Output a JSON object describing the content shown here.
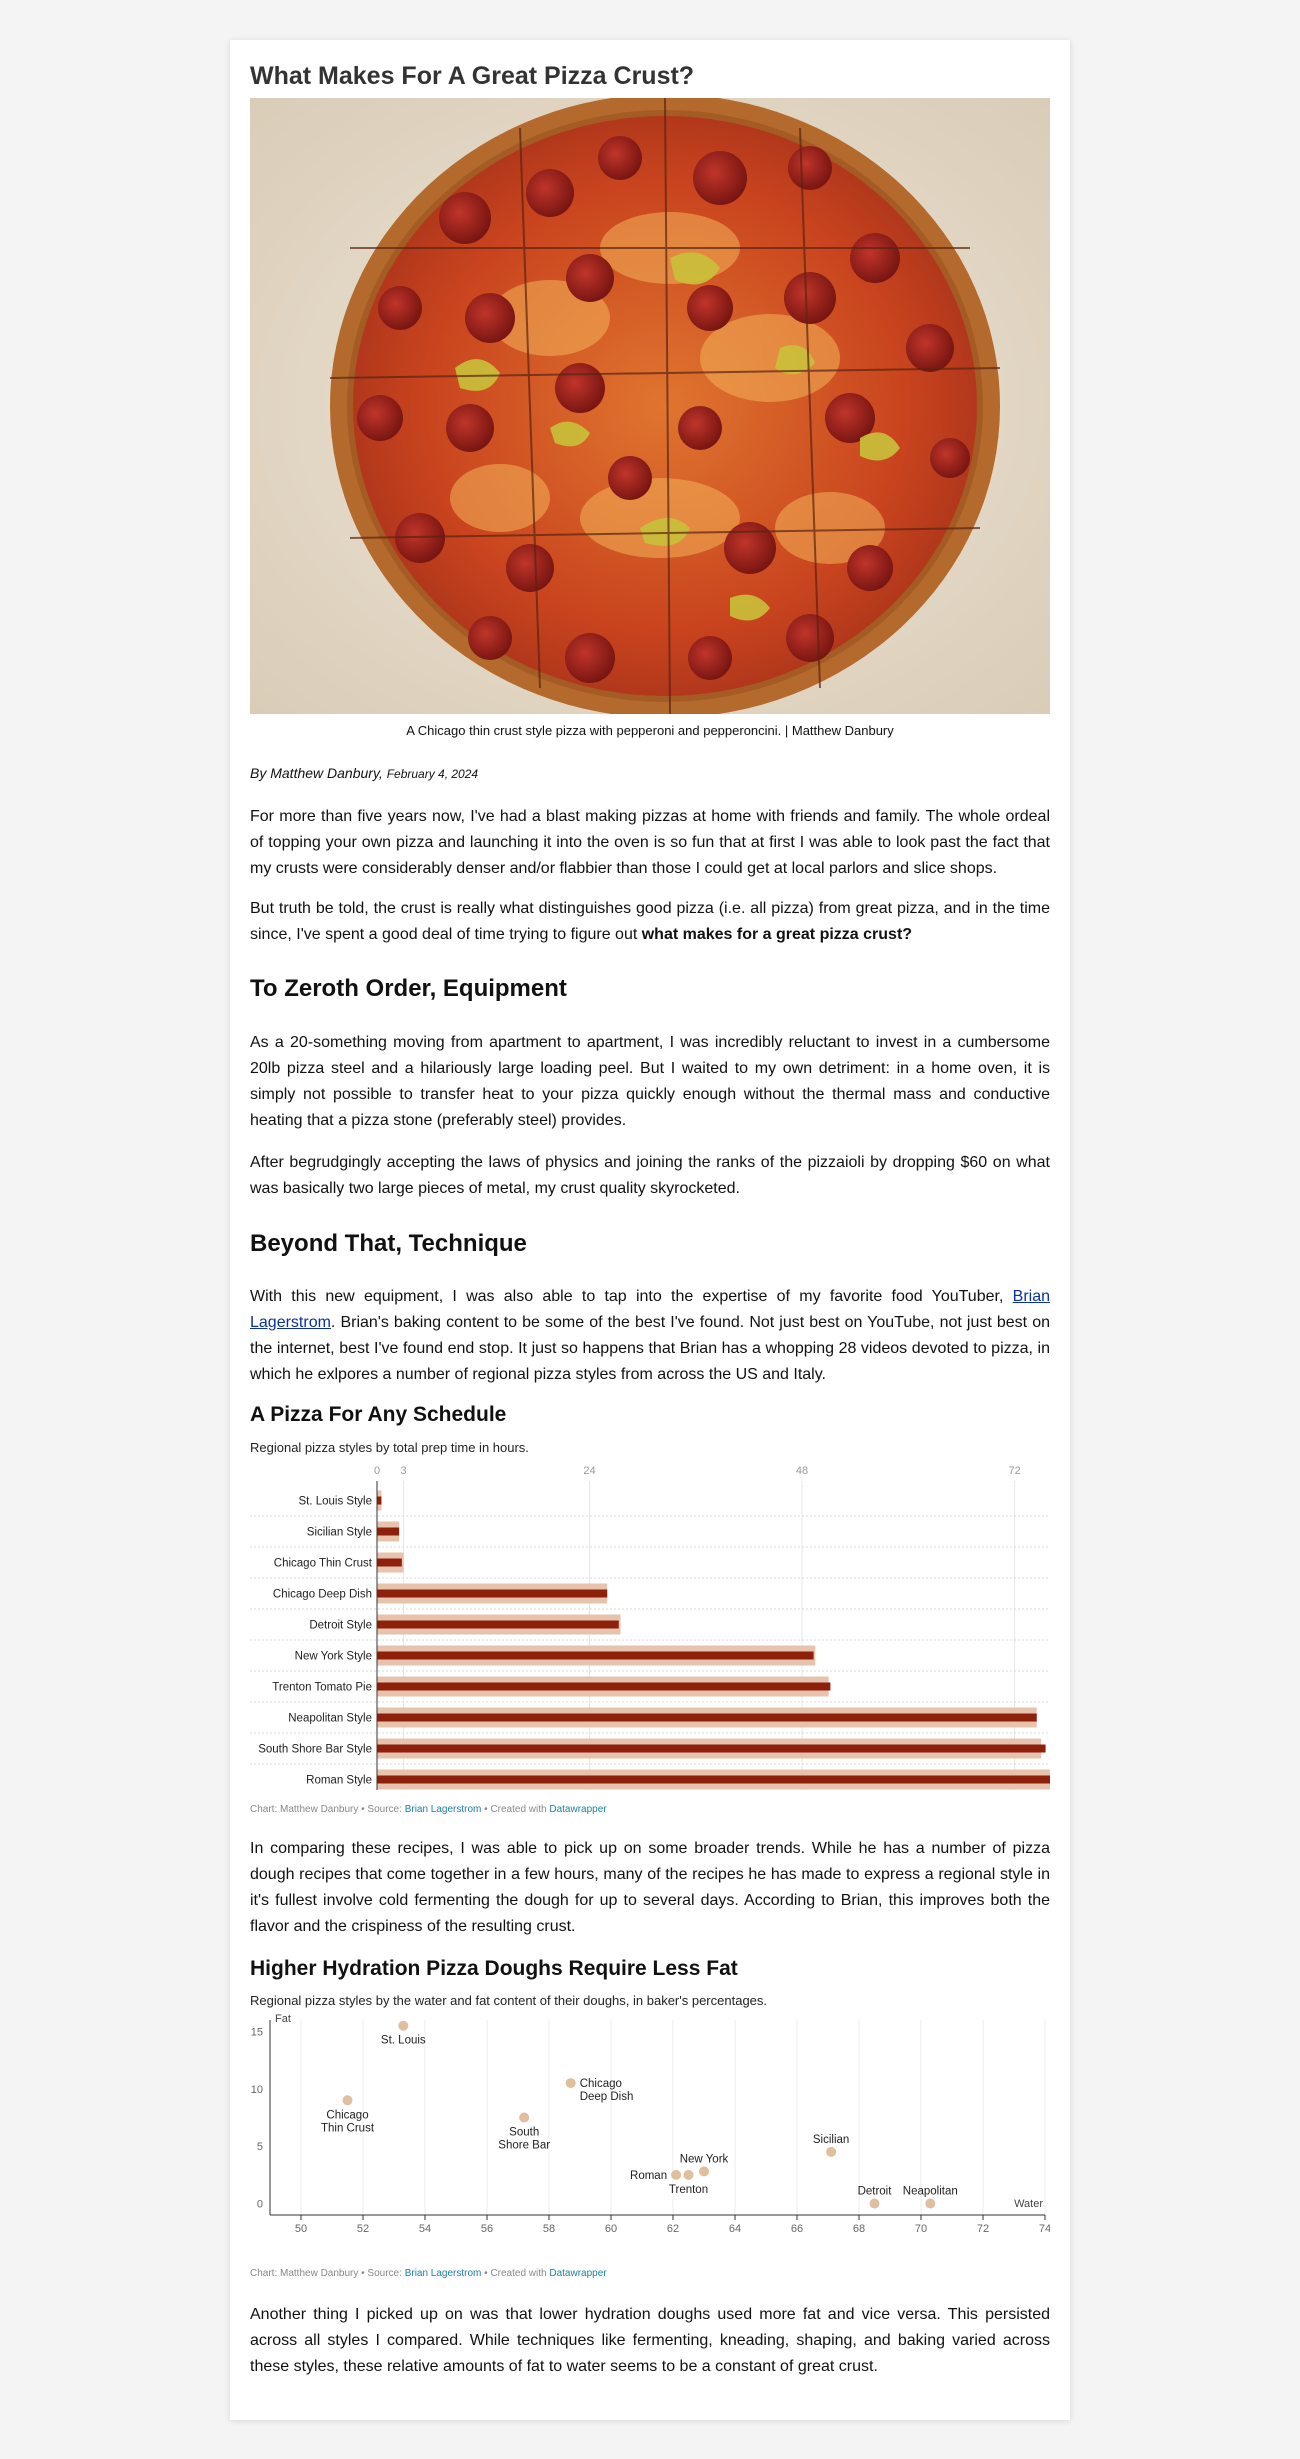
{
  "article": {
    "title": "What Makes For A Great Pizza Crust?",
    "image_caption": "A Chicago thin crust style pizza with pepperoni and pepperoncini. | Matthew Danbury",
    "byline": "By Matthew Danbury,",
    "date": "February 4, 2024",
    "p1": "For more than five years now, I've had a blast making pizzas at home with friends and family. The whole ordeal of topping your own pizza and launching it into the oven is so fun that at first I was able to look past the fact that my crusts were considerably denser and/or flabbier than those I could get at local parlors and slice shops.",
    "p2_start": "But truth be told, the crust is really what distinguishes good pizza (i.e. all pizza) from great pizza, and in the time since, I've spent a good deal of time trying to figure out ",
    "p2_bold": "what makes for a great pizza crust?",
    "h_equipment": "To Zeroth Order, Equipment",
    "p3": "As a 20-something moving from apartment to apartment, I was incredibly reluctant to invest in a cumbersome 20lb pizza steel and a hilariously large loading peel. But I waited to my own detriment: in a home oven, it is simply not possible to transfer heat to your pizza quickly enough without the thermal mass and conductive heating that a pizza stone (preferably steel) provides.",
    "p4": "After begrudgingly accepting the laws of physics and joining the ranks of the pizzaioli by dropping $60 on what was basically two large pieces of metal, my crust quality skyrocketed.",
    "h_technique": "Beyond That, Technique",
    "p5_start": "With this new equipment, I was also able to tap into the expertise of my favorite food YouTuber, ",
    "p5_link": "Brian Lagerstrom",
    "p5_end": ". Brian's baking content to be some of the best I've found. Not just best on YouTube, not just best on the internet, best I've found end stop. It just so happens that Brian has a whopping 28 videos devoted to pizza, in which he exlpores a number of regional pizza styles from across the US and Italy.",
    "p6": "In comparing these recipes, I was able to pick up on some broader trends. While he has a number of pizza dough recipes that come together in a few hours, many of the recipes he has made to express a regional style in it's fullest involve cold fermenting the dough for up to several days. According to Brian, this improves both the flavor and the crispiness of the resulting crust.",
    "p7": "Another thing I picked up on was that lower hydration doughs used more fat and vice versa. This persisted across all styles I compared. While techniques like fermenting, kneading, shaping, and baking varied across these styles, these relative amounts of fat to water seems to be a constant of great crust."
  },
  "credits": {
    "prefix": "Chart: Matthew Danbury • Source: ",
    "source": "Brian Lagerstrom",
    "mid": " • Created with ",
    "tool": "Datawrapper"
  },
  "chart_data": [
    {
      "type": "bar",
      "title": "A Pizza For Any Schedule",
      "subtitle": "Regional pizza styles by total prep time in hours.",
      "xticks": [
        0,
        3,
        24,
        48,
        72
      ],
      "xlim": [
        0,
        76
      ],
      "categories": [
        "St. Louis Style",
        "Sicilian Style",
        "Chicago Thin Crust",
        "Chicago Deep Dish",
        "Detroit Style",
        "New York Style",
        "Trenton Tomato Pie",
        "Neapolitan Style",
        "South Shore Bar Style",
        "Roman Style"
      ],
      "series": [
        {
          "color": "#e7c3ad",
          "values": [
            0.5,
            2.5,
            3,
            26,
            27.5,
            49.5,
            51,
            74.5,
            75,
            76
          ]
        },
        {
          "color": "#8e1f0b",
          "values": [
            0.5,
            2.5,
            2.8,
            26,
            27.3,
            49.3,
            51.2,
            74.5,
            75.5,
            76
          ]
        }
      ],
      "grid": true
    },
    {
      "type": "scatter",
      "title": "Higher Hydration Pizza Doughs Require Less Fat",
      "subtitle": "Regional pizza styles by the water and fat content of their doughs, in baker's percentages.",
      "xlabel": "Water",
      "ylabel": "Fat",
      "xlim": [
        49,
        74
      ],
      "ylim": [
        -1,
        16
      ],
      "xticks": [
        50,
        52,
        54,
        56,
        58,
        60,
        62,
        64,
        66,
        68,
        70,
        72,
        74
      ],
      "yticks": [
        0,
        5,
        10,
        15
      ],
      "color": "#dfbf9d",
      "points": [
        {
          "label": "St. Louis",
          "x": 53.3,
          "y": 15.5,
          "pos": "below"
        },
        {
          "label": "Chicago\nThin Crust",
          "x": 51.5,
          "y": 9.0,
          "pos": "below"
        },
        {
          "label": "Chicago\nDeep Dish",
          "x": 58.7,
          "y": 10.5,
          "pos": "right"
        },
        {
          "label": "South\nShore Bar",
          "x": 57.2,
          "y": 7.5,
          "pos": "below"
        },
        {
          "label": "Roman",
          "x": 62.1,
          "y": 2.5,
          "pos": "left"
        },
        {
          "label": "Trenton",
          "x": 62.5,
          "y": 2.5,
          "pos": "below"
        },
        {
          "label": "New York",
          "x": 63.0,
          "y": 2.8,
          "pos": "above"
        },
        {
          "label": "Sicilian",
          "x": 67.1,
          "y": 4.5,
          "pos": "above"
        },
        {
          "label": "Detroit",
          "x": 68.5,
          "y": 0.0,
          "pos": "above"
        },
        {
          "label": "Neapolitan",
          "x": 70.3,
          "y": 0.0,
          "pos": "above"
        }
      ]
    }
  ]
}
